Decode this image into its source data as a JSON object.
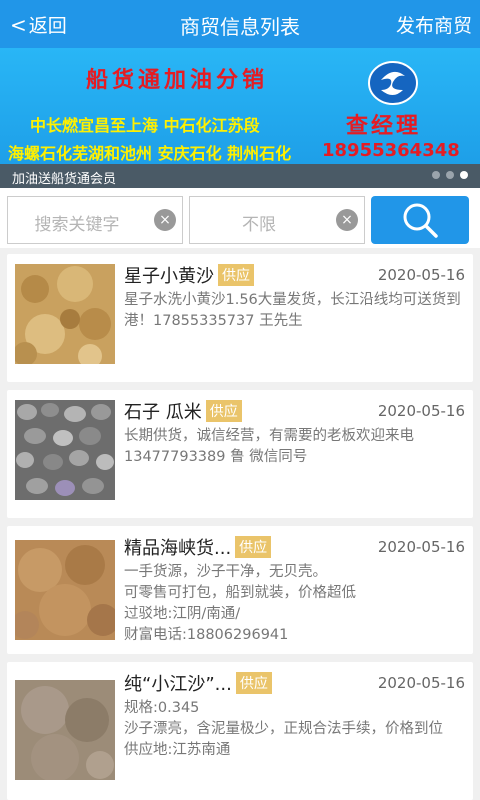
{
  "header": {
    "back_label": "返回",
    "title": "商贸信息列表",
    "publish_label": "发布商贸"
  },
  "banner": {
    "slogan": "船货通加油分销",
    "line1": "中长燃宜昌至上海   中石化江苏段",
    "line2": "海螺石化芜湖和池州 安庆石化 荆州石化",
    "contact_name": "查经理",
    "contact_phone": "18955364348",
    "caption": "加油送船货通会员",
    "slide_count": 3,
    "active_slide": 3
  },
  "search": {
    "keyword_placeholder": "搜索关键字",
    "range_placeholder": "不限",
    "clear_glyph": "×"
  },
  "listings": [
    {
      "title": "星子小黄沙",
      "badge": "供应",
      "date": "2020-05-16",
      "desc": "星子水洗小黄沙1.56大量发货，长江沿线均可送货到港！17855335737  王先生",
      "image": "yellow-sand"
    },
    {
      "title": "石子  瓜米",
      "badge": "供应",
      "date": "2020-05-16",
      "desc": "长期供货，诚信经营，有需要的老板欢迎来电13477793389 鲁  微信同号",
      "image": "gravel"
    },
    {
      "title": "精品海峡货...",
      "badge": "供应",
      "date": "2020-05-16",
      "desc": "一手货源，沙子干净，无贝壳。\n可零售可打包，船到就装，价格超低\n过驳地:江阴/南通/\n财富电话:18806296941",
      "image": "sea-sand"
    },
    {
      "title": "纯“小江沙”...",
      "badge": "供应",
      "date": "2020-05-16",
      "desc": "规格:0.345\n沙子漂亮，含泥量极少，正规合法手续，价格到位\n供应地:江苏南通",
      "image": "river-sand"
    }
  ],
  "colors": {
    "primary": "#2196e8",
    "badge": "#eac46a",
    "banner_red": "#e51c23",
    "banner_yellow": "#fff000"
  }
}
